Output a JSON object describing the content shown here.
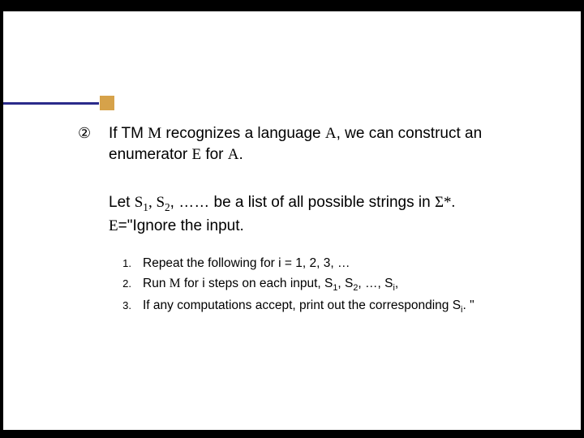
{
  "main": {
    "point_number": "②",
    "statement_part1": "If TM ",
    "statement_m": "M",
    "statement_part2": " recognizes a language ",
    "statement_a1": "A",
    "statement_part3": ", we can construct an enumerator ",
    "statement_e": "E",
    "statement_part4": " for ",
    "statement_a2": "A",
    "statement_part5": "."
  },
  "setup": {
    "part1": "Let ",
    "s1": "S",
    "sub1": "1",
    "comma1": ", ",
    "s2": "S",
    "sub2": "2",
    "part2": ", …… be a list of all possible strings in ",
    "sigma": "Σ",
    "star": "*.",
    "line2_e": "E",
    "line2_rest": "=\"Ignore the input."
  },
  "steps": {
    "n1": "1.",
    "t1": "Repeat the following for i = 1, 2, 3, …",
    "n2": "2.",
    "t2a": "Run ",
    "t2m": "M",
    "t2b": " for i steps on each input, S",
    "t2s1": "1",
    "t2c": ", S",
    "t2s2": "2",
    "t2d": ", …, S",
    "t2si": "i",
    "t2e": ",",
    "n3": "3.",
    "t3a": "If any computations accept, print out the corresponding S",
    "t3si": "i",
    "t3b": ". \""
  }
}
